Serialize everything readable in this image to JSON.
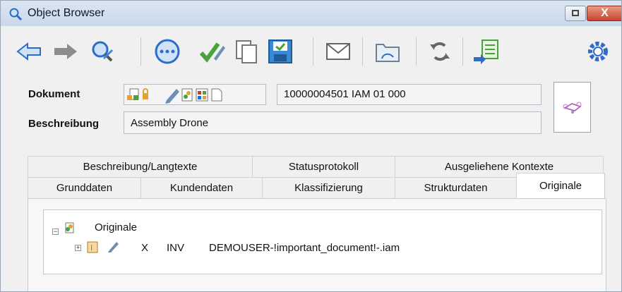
{
  "window": {
    "title": "Object Browser",
    "close_glyph": "X"
  },
  "toolbar": {
    "icons": [
      "back-arrow-icon",
      "forward-arrow-icon",
      "search-object-icon",
      "more-options-icon",
      "check-edit-icon",
      "copy-icon",
      "save-icon",
      "mail-icon",
      "folder-icon",
      "refresh-icon",
      "export-icon",
      "settings-gear-icon"
    ]
  },
  "form": {
    "dokument_label": "Dokument",
    "dokument_number": "10000004501  IAM  01  000",
    "beschreibung_label": "Beschreibung",
    "beschreibung_value": "Assembly Drone"
  },
  "tabs": {
    "row1": [
      "Beschreibung/Langtexte",
      "Statusprotokoll",
      "Ausgeliehene Kontexte"
    ],
    "row2": [
      "Grunddaten",
      "Kundendaten",
      "Klassifizierung",
      "Strukturdaten",
      "Originale"
    ],
    "active": "Originale"
  },
  "tree": {
    "root_label": "Originale",
    "child": {
      "flag": "X",
      "type": "INV",
      "filename": "DEMOUSER-!important_document!-.iam"
    }
  },
  "colors": {
    "accent_blue": "#2d6cc9",
    "green_check": "#4aa33a",
    "close_red": "#c8432b"
  }
}
